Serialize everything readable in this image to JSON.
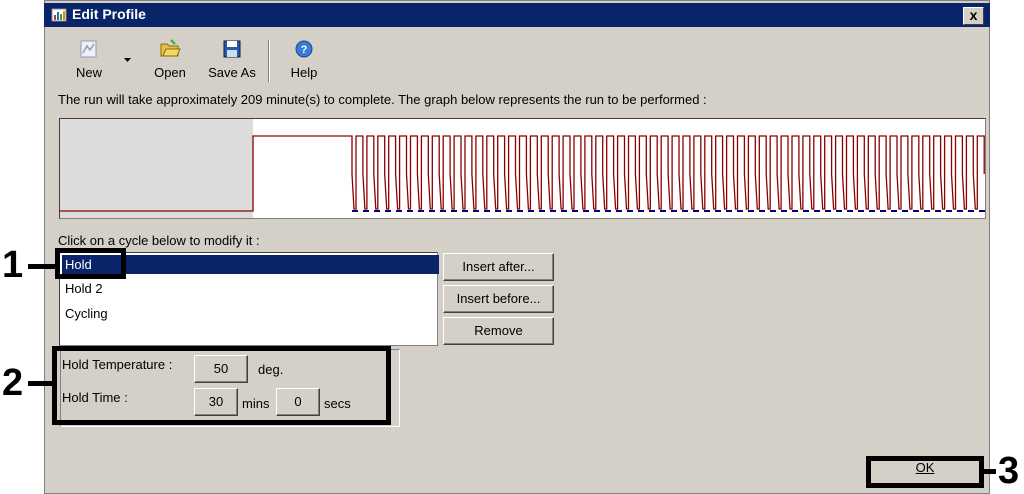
{
  "window": {
    "title": "Edit Profile",
    "close_glyph": "x"
  },
  "toolbar": {
    "new_label": "New",
    "open_label": "Open",
    "save_as_label": "Save As",
    "help_label": "Help"
  },
  "run_message": "The run will take approximately 209 minute(s) to complete. The graph below represents the run to be performed :",
  "cycle_section": {
    "instruction": "Click on a cycle below to modify it :",
    "items": [
      "Hold",
      "Hold 2",
      "Cycling"
    ],
    "selected_index": 0,
    "insert_after_label": "Insert after...",
    "insert_before_label": "Insert before...",
    "remove_label": "Remove"
  },
  "hold_settings": {
    "temperature_label": "Hold Temperature :",
    "temperature_value": "50",
    "temperature_unit": "deg.",
    "time_label": "Hold Time :",
    "time_minutes_value": "30",
    "minutes_unit": "mins",
    "time_seconds_value": "0",
    "seconds_unit": "secs"
  },
  "ok_label": "OK",
  "annotations": {
    "label_1": "1",
    "label_2": "2",
    "label_3": "3"
  },
  "colors": {
    "titlebar": "#0a246a",
    "selection": "#0a246a",
    "graph_line": "#8b0000",
    "graph_low": "#000080",
    "dialog_bg": "#d4d0c8"
  }
}
